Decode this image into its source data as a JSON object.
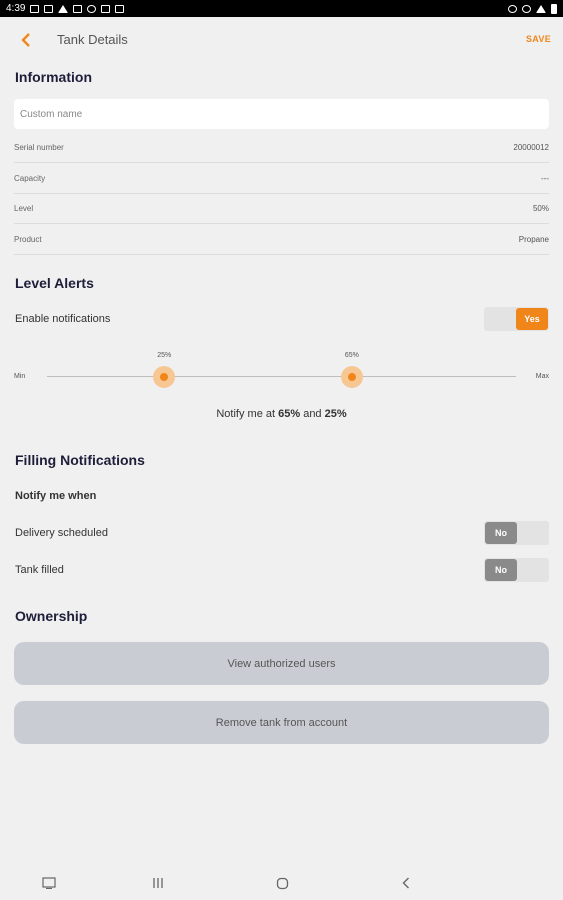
{
  "status_bar": {
    "time": "4:39"
  },
  "app_bar": {
    "title": "Tank Details",
    "save_label": "SAVE"
  },
  "information": {
    "title": "Information",
    "custom_name_placeholder": "Custom name",
    "rows": [
      {
        "label": "Serial number",
        "value": "20000012"
      },
      {
        "label": "Capacity",
        "value": "---"
      },
      {
        "label": "Level",
        "value": "50%"
      },
      {
        "label": "Product",
        "value": "Propane"
      }
    ]
  },
  "level_alerts": {
    "title": "Level Alerts",
    "enable_label": "Enable notifications",
    "enable_value": "Yes",
    "slider": {
      "min_label": "Min",
      "max_label": "Max",
      "low_label": "25%",
      "high_label": "65%",
      "low_value": 25,
      "high_value": 65
    },
    "summary_prefix": "Notify me at ",
    "summary_high": "65%",
    "summary_and": " and ",
    "summary_low": "25%"
  },
  "filling": {
    "title": "Filling Notifications",
    "subtitle": "Notify me when",
    "delivery_label": "Delivery scheduled",
    "delivery_value": "No",
    "filled_label": "Tank filled",
    "filled_value": "No"
  },
  "ownership": {
    "title": "Ownership",
    "view_users_label": "View authorized users",
    "remove_tank_label": "Remove tank from account"
  },
  "colors": {
    "accent": "#f0861a",
    "toggle_off": "#8a8a8a",
    "button_bg": "#c9cdd3"
  },
  "icons": {
    "back": "chevron-left-icon",
    "nav_screenshot": "screenshot-icon",
    "nav_recents": "recents-icon",
    "nav_home": "home-icon",
    "nav_back": "back-icon"
  }
}
